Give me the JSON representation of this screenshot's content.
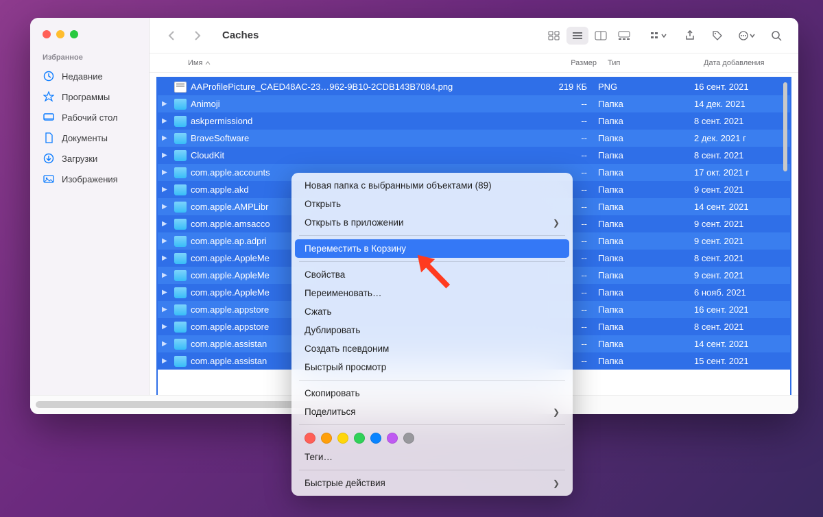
{
  "window": {
    "title": "Caches"
  },
  "sidebar": {
    "section_label": "Избранное",
    "items": [
      {
        "icon": "clock",
        "label": "Недавние"
      },
      {
        "icon": "apps",
        "label": "Программы"
      },
      {
        "icon": "desktop",
        "label": "Рабочий стол"
      },
      {
        "icon": "doc",
        "label": "Документы"
      },
      {
        "icon": "download",
        "label": "Загрузки"
      },
      {
        "icon": "image",
        "label": "Изображения"
      }
    ]
  },
  "columns": {
    "name": "Имя",
    "size": "Размер",
    "type": "Тип",
    "date": "Дата добавления"
  },
  "rows": [
    {
      "kind": "file",
      "name": "AAProfilePicture_CAED48AC-23…962-9B10-2CDB143B7084.png",
      "size": "219 КБ",
      "type": "PNG",
      "date": "16 сент. 2021"
    },
    {
      "kind": "folder",
      "name": "Animoji",
      "size": "--",
      "type": "Папка",
      "date": "14 дек. 2021"
    },
    {
      "kind": "folder",
      "name": "askpermissiond",
      "size": "--",
      "type": "Папка",
      "date": "8 сент. 2021"
    },
    {
      "kind": "folder",
      "name": "BraveSoftware",
      "size": "--",
      "type": "Папка",
      "date": "2 дек. 2021 г"
    },
    {
      "kind": "folder",
      "name": "CloudKit",
      "size": "--",
      "type": "Папка",
      "date": "8 сент. 2021"
    },
    {
      "kind": "folder",
      "name": "com.apple.accounts",
      "size": "--",
      "type": "Папка",
      "date": "17 окт. 2021 г"
    },
    {
      "kind": "folder",
      "name": "com.apple.akd",
      "size": "--",
      "type": "Папка",
      "date": "9 сент. 2021"
    },
    {
      "kind": "folder",
      "name": "com.apple.AMPLibr",
      "size": "--",
      "type": "Папка",
      "date": "14 сент. 2021"
    },
    {
      "kind": "folder",
      "name": "com.apple.amsacco",
      "size": "--",
      "type": "Папка",
      "date": "9 сент. 2021"
    },
    {
      "kind": "folder",
      "name": "com.apple.ap.adpri",
      "size": "--",
      "type": "Папка",
      "date": "9 сент. 2021"
    },
    {
      "kind": "folder",
      "name": "com.apple.AppleMe",
      "size": "--",
      "type": "Папка",
      "date": "8 сент. 2021"
    },
    {
      "kind": "folder",
      "name": "com.apple.AppleMe",
      "size": "--",
      "type": "Папка",
      "date": "9 сент. 2021"
    },
    {
      "kind": "folder",
      "name": "com.apple.AppleMe",
      "size": "--",
      "type": "Папка",
      "date": "6 нояб. 2021"
    },
    {
      "kind": "folder",
      "name": "com.apple.appstore",
      "size": "--",
      "type": "Папка",
      "date": "16 сент. 2021"
    },
    {
      "kind": "folder",
      "name": "com.apple.appstore",
      "size": "--",
      "type": "Папка",
      "date": "8 сент. 2021"
    },
    {
      "kind": "folder",
      "name": "com.apple.assistan",
      "size": "--",
      "type": "Папка",
      "date": "14 сент. 2021"
    },
    {
      "kind": "folder",
      "name": "com.apple.assistan",
      "size": "--",
      "type": "Папка",
      "date": "15 сент. 2021"
    }
  ],
  "context_menu": {
    "items": [
      {
        "label": "Новая папка с выбранными объектами (89)",
        "sub": false
      },
      {
        "label": "Открыть",
        "sub": false
      },
      {
        "label": "Открыть в приложении",
        "sub": true
      },
      {
        "sep": true
      },
      {
        "label": "Переместить в Корзину",
        "sub": false,
        "hover": true
      },
      {
        "sep": true
      },
      {
        "label": "Свойства",
        "sub": false
      },
      {
        "label": "Переименовать…",
        "sub": false
      },
      {
        "label": "Сжать",
        "sub": false
      },
      {
        "label": "Дублировать",
        "sub": false
      },
      {
        "label": "Создать псевдоним",
        "sub": false
      },
      {
        "label": "Быстрый просмотр",
        "sub": false
      },
      {
        "sep": true
      },
      {
        "label": "Скопировать",
        "sub": false
      },
      {
        "label": "Поделиться",
        "sub": true
      },
      {
        "sep": true
      },
      {
        "tags": true
      },
      {
        "label": "Теги…",
        "sub": false
      },
      {
        "sep": true
      },
      {
        "label": "Быстрые действия",
        "sub": true
      }
    ],
    "tag_colors": [
      "#ff5f57",
      "#ff9f0a",
      "#ffd60a",
      "#30d158",
      "#0a84ff",
      "#bf5af2",
      "#98989d"
    ]
  }
}
